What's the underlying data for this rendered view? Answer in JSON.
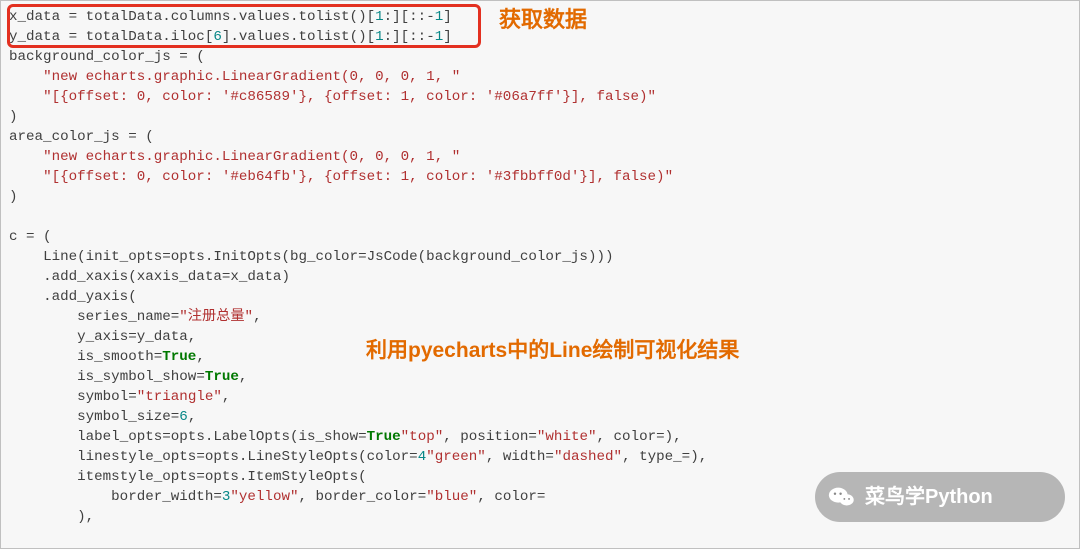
{
  "code": {
    "lines": [
      {
        "plain": "x_data = totalData.columns.values.tolist()[",
        "num": "1",
        "mid": ":][::-",
        "num2": "1",
        "end": "]"
      },
      {
        "plain": "y_data = totalData.iloc[",
        "num": "6",
        "mid": "].values.tolist()[",
        "num2": "1",
        "mid2": ":][::-",
        "num3": "1",
        "end": "]"
      },
      {
        "plain": "background_color_js = ("
      },
      {
        "indent": "    ",
        "str": "\"new echarts.graphic.LinearGradient(0, 0, 0, 1, \""
      },
      {
        "indent": "    ",
        "str": "\"[{offset: 0, color: '#c86589'}, {offset: 1, color: '#06a7ff'}], false)\""
      },
      {
        "plain": ")"
      },
      {
        "plain": "area_color_js = ("
      },
      {
        "indent": "    ",
        "str": "\"new echarts.graphic.LinearGradient(0, 0, 0, 1, \""
      },
      {
        "indent": "    ",
        "str": "\"[{offset: 0, color: '#eb64fb'}, {offset: 1, color: '#3fbbff0d'}], false)\""
      },
      {
        "plain": ")"
      },
      {
        "plain": ""
      },
      {
        "plain": "c = ("
      },
      {
        "indent": "    ",
        "plain": "Line(init_opts=opts.InitOpts(bg_color=JsCode(background_color_js)))"
      },
      {
        "indent": "    ",
        "plain": ".add_xaxis(xaxis_data=x_data)"
      },
      {
        "indent": "    ",
        "plain": ".add_yaxis("
      },
      {
        "indent": "        ",
        "plain": "series_name=",
        "str": "\"注册总量\"",
        "after": ","
      },
      {
        "indent": "        ",
        "plain": "y_axis=y_data,"
      },
      {
        "indent": "        ",
        "plain": "is_smooth=",
        "kw": "True",
        "after": ","
      },
      {
        "indent": "        ",
        "plain": "is_symbol_show=",
        "kw": "True",
        "after": ","
      },
      {
        "indent": "        ",
        "plain": "symbol=",
        "str": "\"triangle\"",
        "after": ","
      },
      {
        "indent": "        ",
        "plain": "symbol_size=",
        "num": "6",
        "after": ","
      },
      {
        "indent": "        ",
        "plain": "label_opts=opts.LabelOpts(is_show=",
        "kw": "True",
        "after": ", position=",
        "str": "\"top\"",
        "after2": ", color=",
        "str2": "\"white\"",
        "end": "),"
      },
      {
        "indent": "        ",
        "plain": "linestyle_opts=opts.LineStyleOpts(color=",
        "str": "\"green\"",
        "after": ", width=",
        "num": "4",
        "after2": ", type_=",
        "str2": "\"dashed\"",
        "end": "),"
      },
      {
        "indent": "        ",
        "plain": "itemstyle_opts=opts.ItemStyleOpts("
      },
      {
        "indent": "            ",
        "plain": "border_width=",
        "num": "3",
        "after": ", border_color=",
        "str": "\"yellow\"",
        "after2": ", color=",
        "str2": "\"blue\"",
        "end": ""
      },
      {
        "indent": "        ",
        "plain": "),"
      }
    ]
  },
  "annotations": {
    "box_label": "获取数据",
    "line_label": "利用pyecharts中的Line绘制可视化结果"
  },
  "watermark": {
    "text": "菜鸟学Python",
    "icon": "wechat-icon"
  }
}
